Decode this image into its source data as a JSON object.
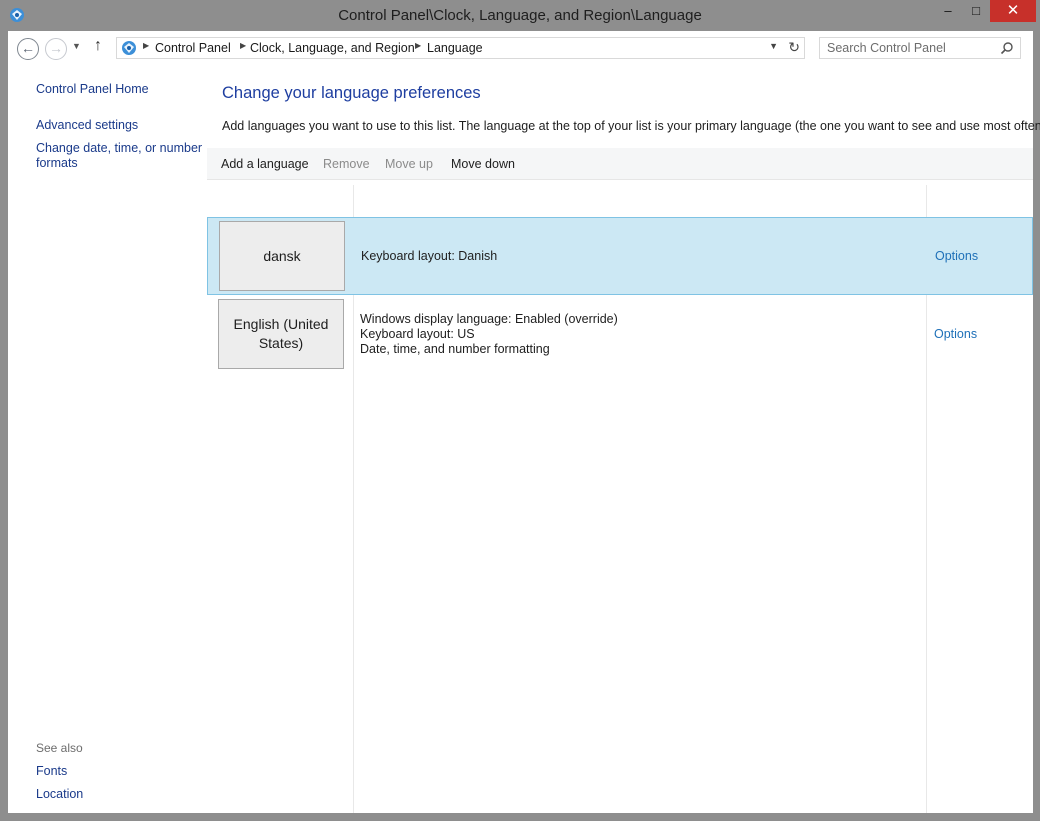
{
  "window": {
    "title": "Control Panel\\Clock, Language, and Region\\Language",
    "min_glyph": "–",
    "max_glyph": "□",
    "close_glyph": "✕"
  },
  "nav": {
    "back_glyph": "←",
    "forward_glyph": "→",
    "recent_glyph": "▼",
    "up_glyph": "↑"
  },
  "address": {
    "crumbs": [
      "Control Panel",
      "Clock, Language, and Region",
      "Language"
    ],
    "separator": "▶",
    "dropdown_glyph": "▼",
    "refresh_glyph": "↻"
  },
  "search": {
    "placeholder": "Search Control Panel"
  },
  "sidebar": {
    "home": "Control Panel Home",
    "links": [
      "Advanced settings",
      "Change date, time, or number formats"
    ],
    "see_also_label": "See also",
    "see_also_links": [
      "Fonts",
      "Location"
    ]
  },
  "main": {
    "heading": "Change your language preferences",
    "description": "Add languages you want to use to this list. The language at the top of your list is your primary language (the one you want to see and use most often).",
    "toolbar": {
      "add": "Add a language",
      "remove": "Remove",
      "move_up": "Move up",
      "move_down": "Move down"
    },
    "languages": [
      {
        "name": "dansk",
        "details": [
          "Keyboard layout: Danish"
        ],
        "options": "Options",
        "selected": true
      },
      {
        "name": "English (United States)",
        "details": [
          "Windows display language: Enabled (override)",
          "Keyboard layout: US",
          "Date, time, and number formatting"
        ],
        "options": "Options",
        "selected": false
      }
    ]
  },
  "colors": {
    "link": "#1a3a8a",
    "heading": "#1e3ea0",
    "selection": "#cce8f4",
    "close_button": "#c7302a"
  }
}
